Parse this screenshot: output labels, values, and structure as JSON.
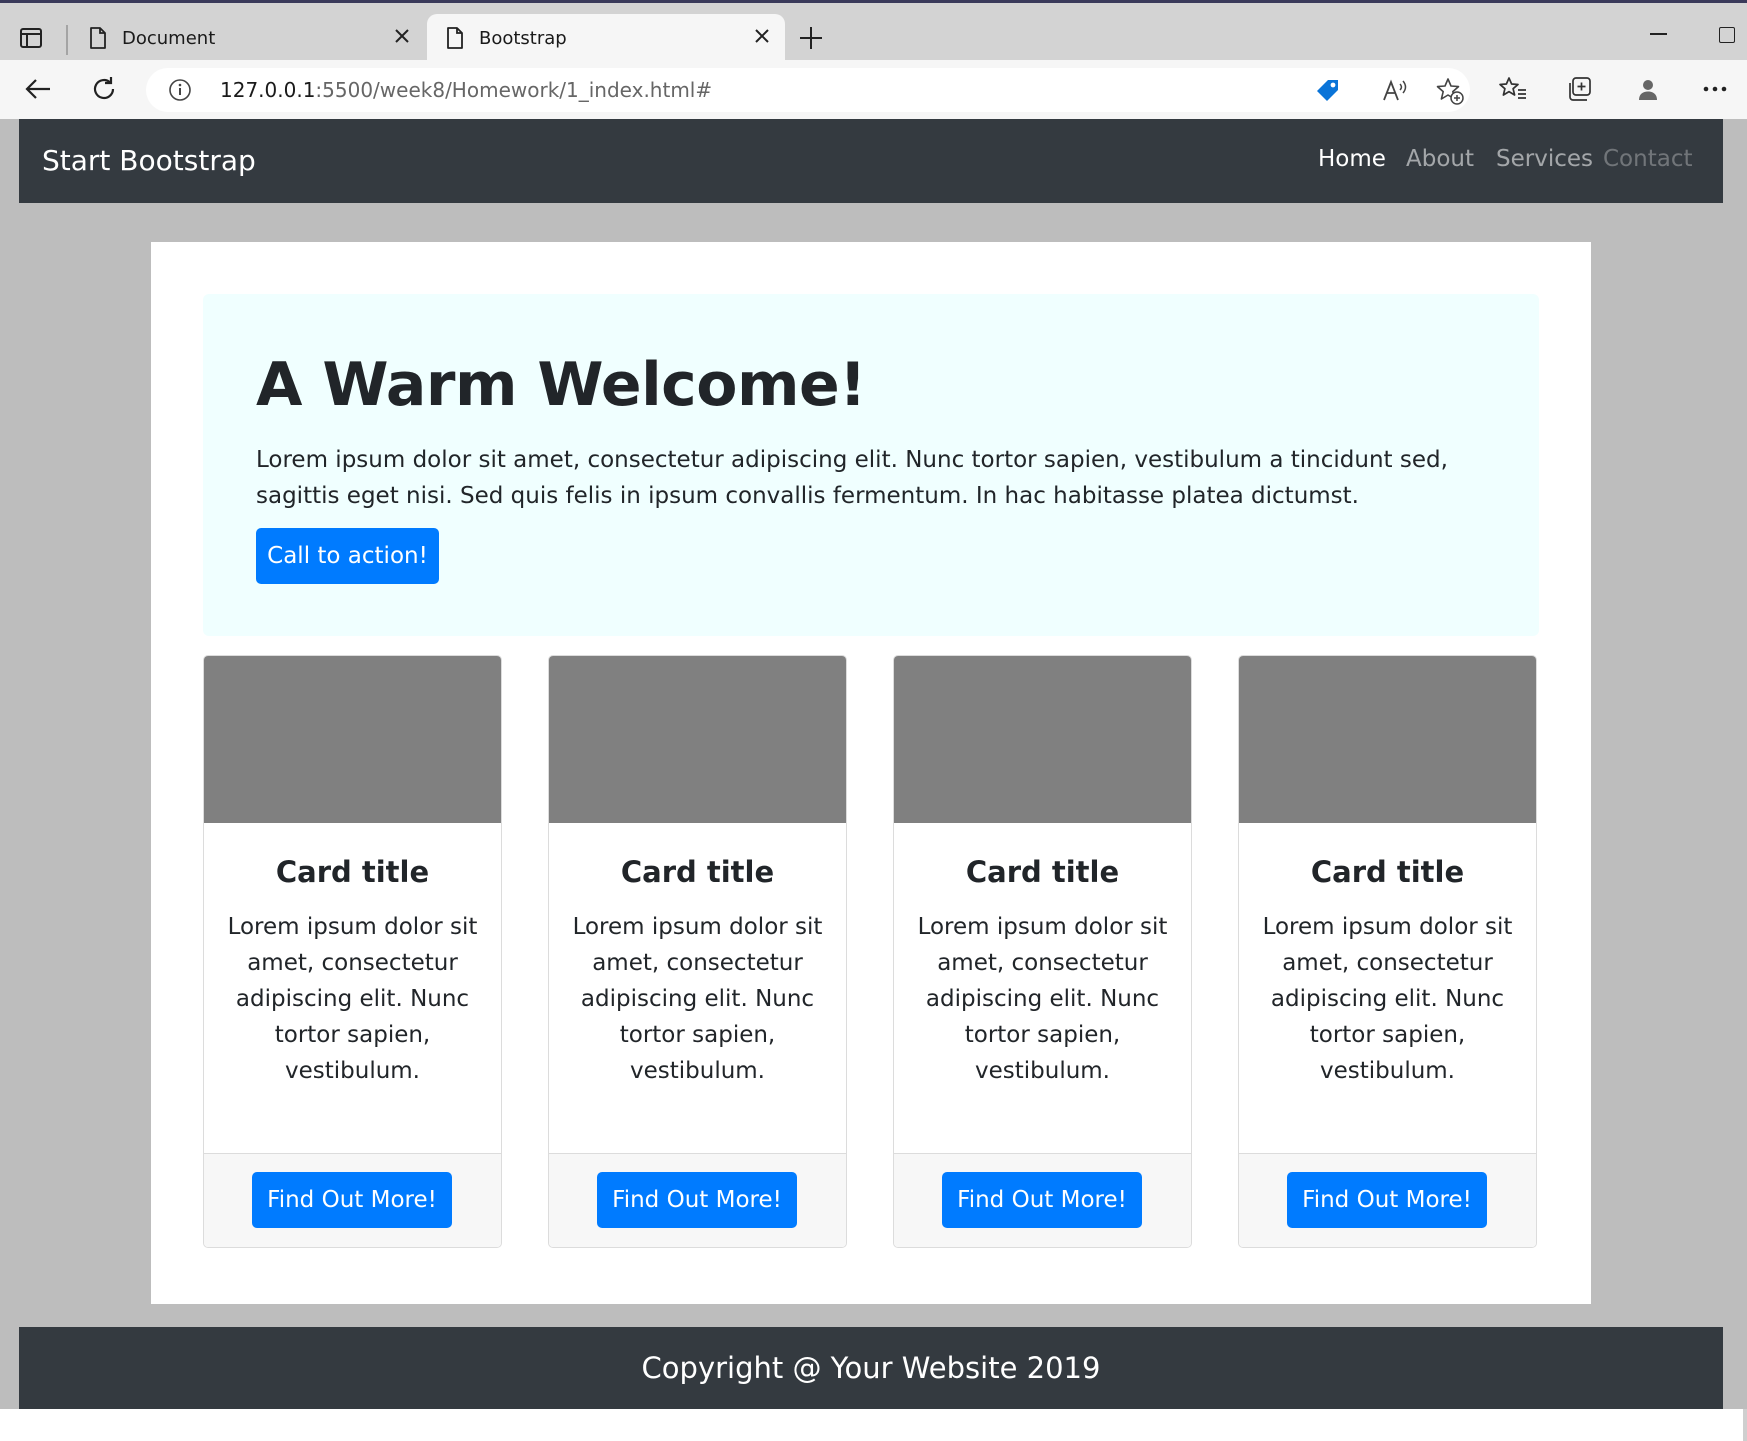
{
  "browser": {
    "tabs": [
      {
        "title": "Document"
      },
      {
        "title": "Bootstrap"
      }
    ],
    "url_host": "127.0.0.1",
    "url_rest": ":5500/week8/Homework/1_index.html#"
  },
  "page": {
    "navbar": {
      "brand": "Start Bootstrap",
      "links": [
        {
          "label": "Home"
        },
        {
          "label": "About"
        },
        {
          "label": "Services"
        },
        {
          "label": "Contact"
        }
      ]
    },
    "jumbotron": {
      "heading": "A Warm Welcome!",
      "text": "Lorem ipsum dolor sit amet, consectetur adipiscing elit. Nunc tortor sapien, vestibulum a tincidunt sed, sagittis eget nisi. Sed quis felis in ipsum convallis fermentum. In hac habitasse platea dictumst.",
      "button": "Call to action!"
    },
    "cards": [
      {
        "title": "Card title",
        "text": "Lorem ipsum dolor sit amet, consectetur adipiscing elit. Nunc tortor sapien, vestibulum.",
        "button": "Find Out More!"
      },
      {
        "title": "Card title",
        "text": "Lorem ipsum dolor sit amet, consectetur adipiscing elit. Nunc tortor sapien, vestibulum.",
        "button": "Find Out More!"
      },
      {
        "title": "Card title",
        "text": "Lorem ipsum dolor sit amet, consectetur adipiscing elit. Nunc tortor sapien, vestibulum.",
        "button": "Find Out More!"
      },
      {
        "title": "Card title",
        "text": "Lorem ipsum dolor sit amet, consectetur adipiscing elit. Nunc tortor sapien, vestibulum.",
        "button": "Find Out More!"
      }
    ],
    "footer": "Copyright @ Your Website 2019"
  },
  "colors": {
    "navbar_bg": "#343a40",
    "primary": "#007bff",
    "jumbotron_bg": "#f0ffff",
    "page_bg": "#bdbdbd",
    "card_image": "#808080"
  },
  "icons": [
    "sidebar-toggle-icon",
    "document-icon",
    "close-icon",
    "plus-icon",
    "back-icon",
    "refresh-icon",
    "info-icon",
    "price-tag-icon",
    "read-aloud-icon",
    "add-favorite-icon",
    "favorites-icon",
    "collections-icon",
    "profile-icon",
    "more-icon"
  ]
}
